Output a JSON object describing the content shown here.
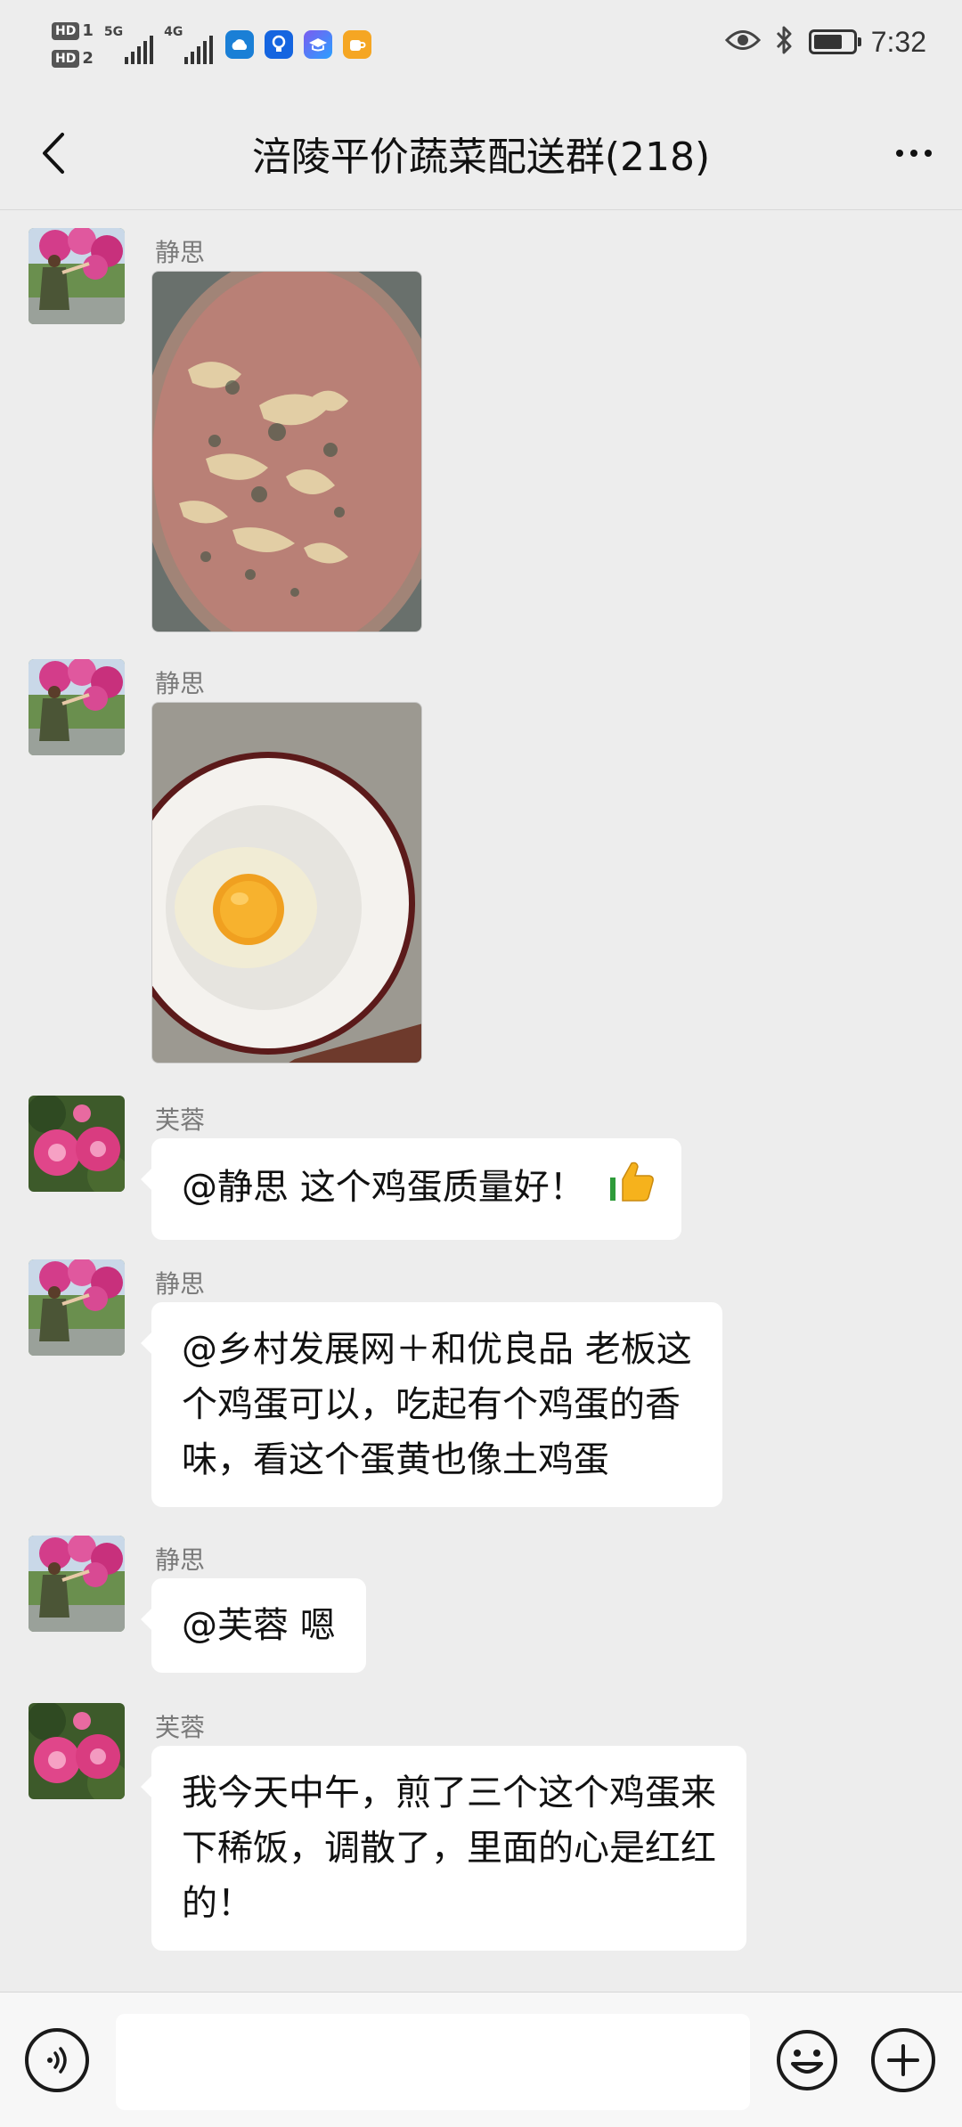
{
  "status_bar": {
    "sim1_label": "HD",
    "sim1_num": "1",
    "sim2_label": "HD",
    "sim2_num": "2",
    "net1": "5G",
    "net2": "4G",
    "time": "7:32",
    "battery_level": 0.75,
    "app_icons": [
      "weather-app-icon",
      "bulb-app-icon",
      "education-app-icon",
      "cup-app-icon"
    ],
    "right_icons": [
      "eye-icon",
      "bluetooth-icon",
      "battery-icon"
    ]
  },
  "header": {
    "title": "涪陵平价蔬菜配送群(218)"
  },
  "messages": [
    {
      "sender": "静思",
      "type": "image",
      "image": "soup-photo"
    },
    {
      "sender": "静思",
      "type": "image",
      "image": "egg-bowl-photo"
    },
    {
      "sender": "芙蓉",
      "type": "text",
      "text": "@静思  这个鸡蛋质量好！",
      "emoji": "👍"
    },
    {
      "sender": "静思",
      "type": "text",
      "lines": [
        "@乡村发展网＋和优良品  老板这",
        "个鸡蛋可以，吃起有个鸡蛋的香",
        "味，看这个蛋黄也像土鸡蛋"
      ]
    },
    {
      "sender": "静思",
      "type": "text",
      "text": "@芙蓉  嗯"
    },
    {
      "sender": "芙蓉",
      "type": "text",
      "lines": [
        "我今天中午，煎了三个这个鸡蛋来",
        "下稀饭，调散了，里面的心是红红",
        "的！"
      ]
    }
  ],
  "input_bar": {
    "placeholder": "",
    "value": ""
  },
  "colors": {
    "background": "#ededed",
    "bubble": "#ffffff",
    "sender_name": "#7a7a7a"
  }
}
